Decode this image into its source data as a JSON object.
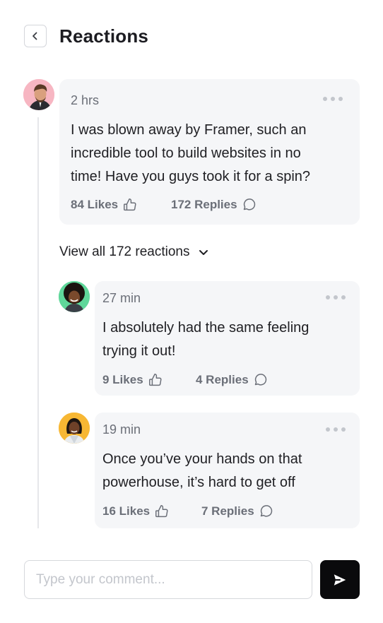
{
  "header": {
    "title": "Reactions"
  },
  "main_comment": {
    "time": "2 hrs",
    "text_lines": [
      "I was blown away by Framer, such an",
      "incredible tool to build websites in no",
      "time! Have you guys took it for a spin?"
    ],
    "likes": "84 Likes",
    "replies": "172 Replies"
  },
  "view_all": {
    "label": "View all 172 reactions"
  },
  "replies": [
    {
      "time": "27 min",
      "text_lines": [
        "I absolutely had the same feeling",
        "trying it out!"
      ],
      "likes": "9 Likes",
      "replies": "4 Replies"
    },
    {
      "time": "19 min",
      "text_lines": [
        "Once you’ve your hands on that",
        "powerhouse, it’s hard to get off"
      ],
      "likes": "16 Likes",
      "replies": "7 Replies"
    }
  ],
  "composer": {
    "placeholder": "Type your comment..."
  },
  "icons": {
    "back": "chevron-left-icon",
    "more": "more-horizontal-icon",
    "like": "thumbs-up-icon",
    "reply": "message-circle-icon",
    "expand": "chevron-down-icon",
    "send": "send-icon"
  },
  "colors": {
    "card_bg": "#f5f6f8",
    "muted_text": "#6b6f78",
    "send_button": "#0a0a0c",
    "avatar_1_bg": "#f7b6c2",
    "avatar_2_bg": "#5fd79a",
    "avatar_3_bg": "#f7b733"
  }
}
